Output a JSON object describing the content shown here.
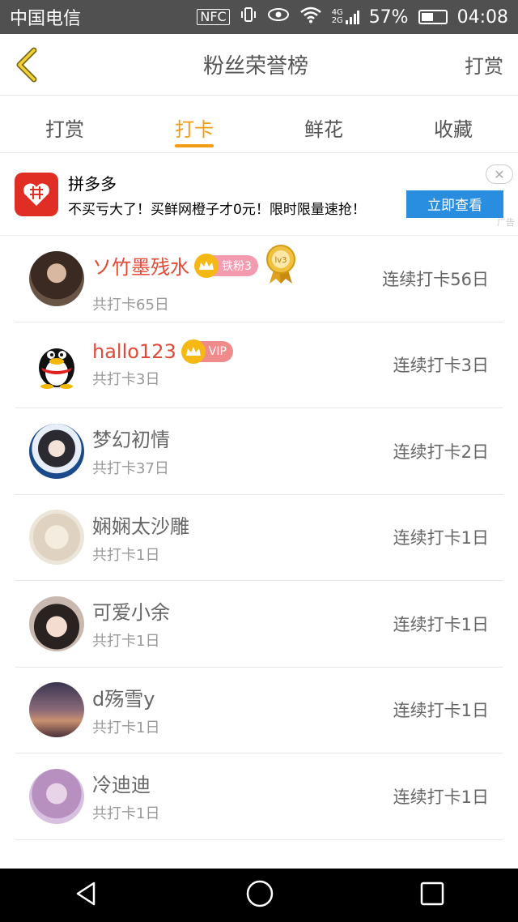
{
  "statusbar": {
    "carrier": "中国电信",
    "nfc": "NFC",
    "network": "4G 2G",
    "battery_pct": "57%",
    "battery_level": 0.57,
    "time": "04:08"
  },
  "topbar": {
    "title": "粉丝荣誉榜",
    "right_action": "打赏"
  },
  "tabs": [
    {
      "label": "打赏",
      "active": false
    },
    {
      "label": "打卡",
      "active": true
    },
    {
      "label": "鲜花",
      "active": false
    },
    {
      "label": "收藏",
      "active": false
    }
  ],
  "ad": {
    "title": "拼多多",
    "desc": "不买亏大了！买鲜网橙子才0元！限时限量速抢！",
    "cta": "立即查看",
    "label": "广告"
  },
  "list": [
    {
      "name": "ソ竹墨残水",
      "sub": "共打卡65日",
      "streak": "连续打卡56日",
      "name_red": true,
      "badge": "铁粉3",
      "level": "lv3"
    },
    {
      "name": "hallo123",
      "sub": "共打卡3日",
      "streak": "连续打卡3日",
      "name_red": true,
      "badge": "VIP"
    },
    {
      "name": "梦幻初情",
      "sub": "共打卡37日",
      "streak": "连续打卡2日"
    },
    {
      "name": "娴娴太沙雕",
      "sub": "共打卡1日",
      "streak": "连续打卡1日"
    },
    {
      "name": "可爱小余",
      "sub": "共打卡1日",
      "streak": "连续打卡1日"
    },
    {
      "name": "d殇雪y",
      "sub": "共打卡1日",
      "streak": "连续打卡1日"
    },
    {
      "name": "冷迪迪",
      "sub": "共打卡1日",
      "streak": "连续打卡1日"
    }
  ],
  "colors": {
    "accent": "#f39c12",
    "vip_red": "#e04a36"
  }
}
